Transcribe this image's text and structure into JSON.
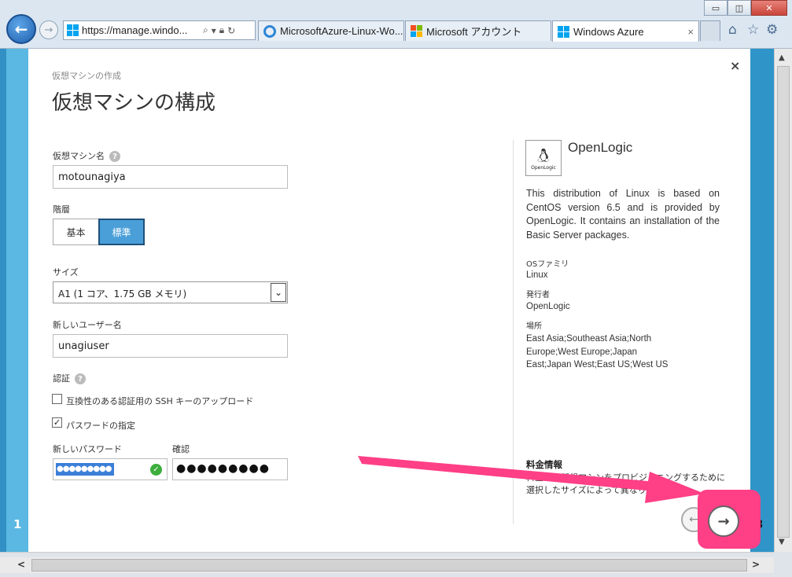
{
  "browser": {
    "url": "https://manage.windo...",
    "tabs": [
      {
        "label": "MicrosoftAzure-Linux-Wo..."
      },
      {
        "label": "Microsoft アカウント"
      },
      {
        "label": "Windows Azure",
        "close": "×"
      }
    ],
    "window_controls": {
      "min": "▭",
      "max": "◫",
      "close": "✕"
    }
  },
  "dialog": {
    "breadcrumb": "仮想マシンの作成",
    "title": "仮想マシンの構成",
    "close": "×",
    "vm_name": {
      "label": "仮想マシン名",
      "help": "?",
      "value": "motounagiya"
    },
    "tier": {
      "label": "階層",
      "options": [
        "基本",
        "標準"
      ],
      "selected": "標準"
    },
    "size": {
      "label": "サイズ",
      "value": "A1 (1 コア、1.75 GB メモリ)"
    },
    "username": {
      "label": "新しいユーザー名",
      "value": "unagiuser"
    },
    "auth": {
      "label": "認証",
      "help": "?",
      "ssh": {
        "label": "互換性のある認証用の SSH キーのアップロード",
        "checked": false
      },
      "password": {
        "label": "パスワードの指定",
        "checked": true,
        "mark": "✓"
      }
    },
    "new_password": {
      "label": "新しいパスワード",
      "value": "●●●●●●●●●"
    },
    "confirm_password": {
      "label": "確認",
      "value": "●●●●●●●●●"
    },
    "step_left": "1",
    "step_right": "3",
    "prev_symbol": "←",
    "next_symbol": "→"
  },
  "info": {
    "publisher_logo_text": "OpenLogic",
    "name": "OpenLogic",
    "description": "This distribution of Linux is based on CentOS version 6.5 and is provided by OpenLogic. It contains an installation of the Basic Server packages.",
    "os_family_label": "OSファミリ",
    "os_family": "Linux",
    "publisher_label": "発行者",
    "publisher": "OpenLogic",
    "location_label": "場所",
    "locations": "East Asia;Southeast Asia;North Europe;West Europe;Japan East;Japan West;East US;West US",
    "pricing_label": "料金情報",
    "pricing_text": "料金は、仮想マシンをプロビジョニングするために選択したサイズによって異なります。"
  },
  "colors": {
    "accent": "#4a9fd8",
    "highlight": "#ff3f86",
    "strip": "#5ab8e2"
  }
}
